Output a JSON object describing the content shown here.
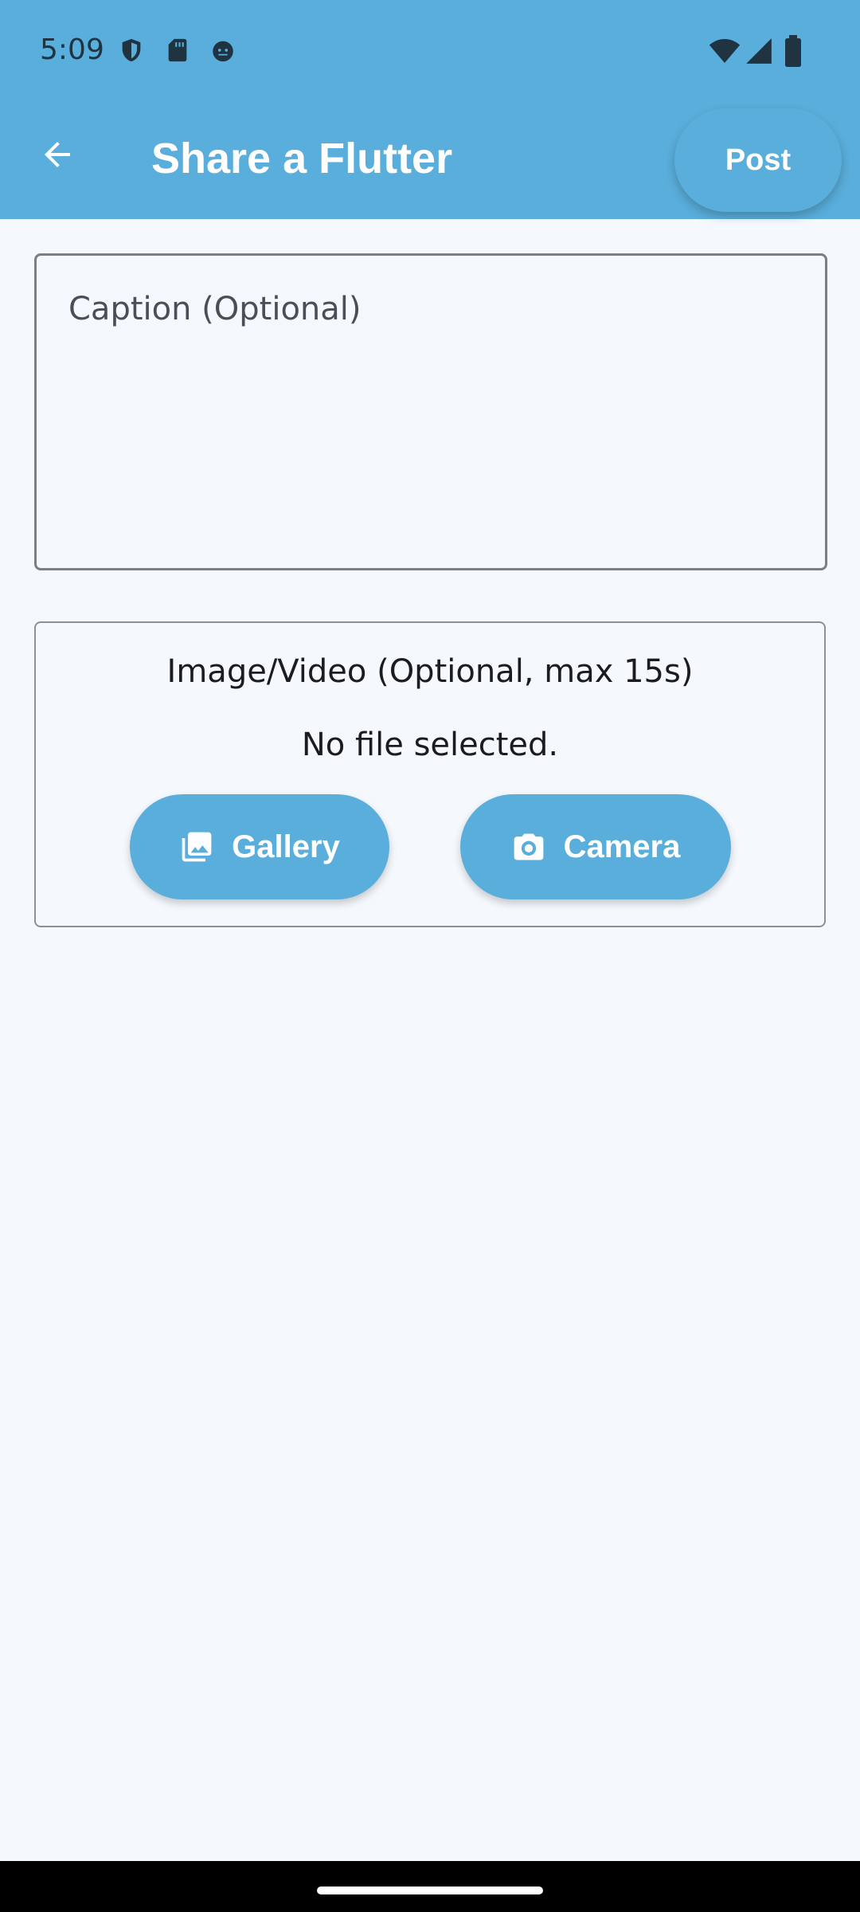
{
  "status_bar": {
    "time": "5:09",
    "left_icons": [
      "shield-icon",
      "sd-card-icon",
      "android-face-icon"
    ],
    "right_icons": [
      "wifi-icon",
      "cell-signal-icon",
      "battery-icon"
    ]
  },
  "app_bar": {
    "back_icon": "arrow-back-icon",
    "title": "Share a Flutter",
    "post_label": "Post"
  },
  "caption": {
    "placeholder": "Caption (Optional)",
    "value": ""
  },
  "media": {
    "title": "Image/Video (Optional, max 15s)",
    "status": "No file selected.",
    "gallery_label": "Gallery",
    "gallery_icon": "photo-library-icon",
    "camera_label": "Camera",
    "camera_icon": "camera-icon"
  },
  "colors": {
    "accent": "#5aaedb",
    "background": "#f5f9fd",
    "on_accent": "#ffffff"
  }
}
